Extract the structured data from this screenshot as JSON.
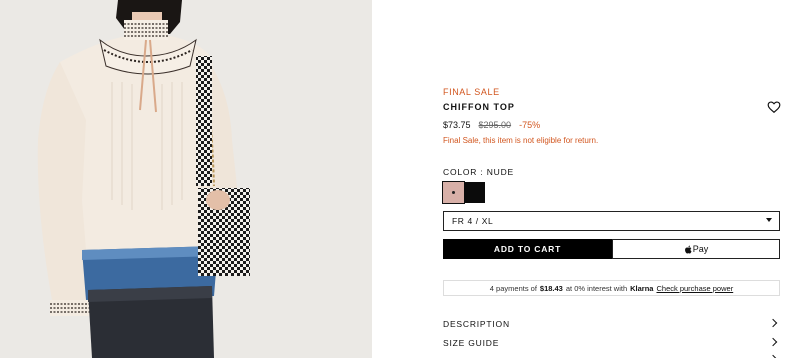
{
  "product": {
    "sale_tag": "FINAL SALE",
    "title": "CHIFFON TOP",
    "price_current": "$73.75",
    "price_original": "$295.00",
    "price_discount": "-75%",
    "return_note": "Final Sale, this item is not eligible for return."
  },
  "color": {
    "label": "COLOR : NUDE",
    "swatches": [
      {
        "name": "Nude",
        "hex": "#d8b0a8",
        "selected": true
      },
      {
        "name": "Black",
        "hex": "#0b0b0b",
        "selected": false
      }
    ]
  },
  "size": {
    "selected": "FR 4 / XL"
  },
  "buttons": {
    "add_to_cart": "ADD TO CART",
    "apple_pay": "Pay"
  },
  "klarna": {
    "prefix": "4 payments of",
    "amount": "$18.43",
    "middle": "at 0% interest with",
    "brand": "Klarna",
    "link": "Check purchase power"
  },
  "accordion": {
    "description": "DESCRIPTION",
    "size_guide": "SIZE GUIDE"
  },
  "icons": {
    "wishlist": "heart-icon",
    "size_dropdown": "caret-down-icon",
    "apple": "apple-icon",
    "expand": "chevron-right-icon"
  },
  "colors": {
    "accent_sale": "#d2561f",
    "primary_button": "#000000"
  }
}
